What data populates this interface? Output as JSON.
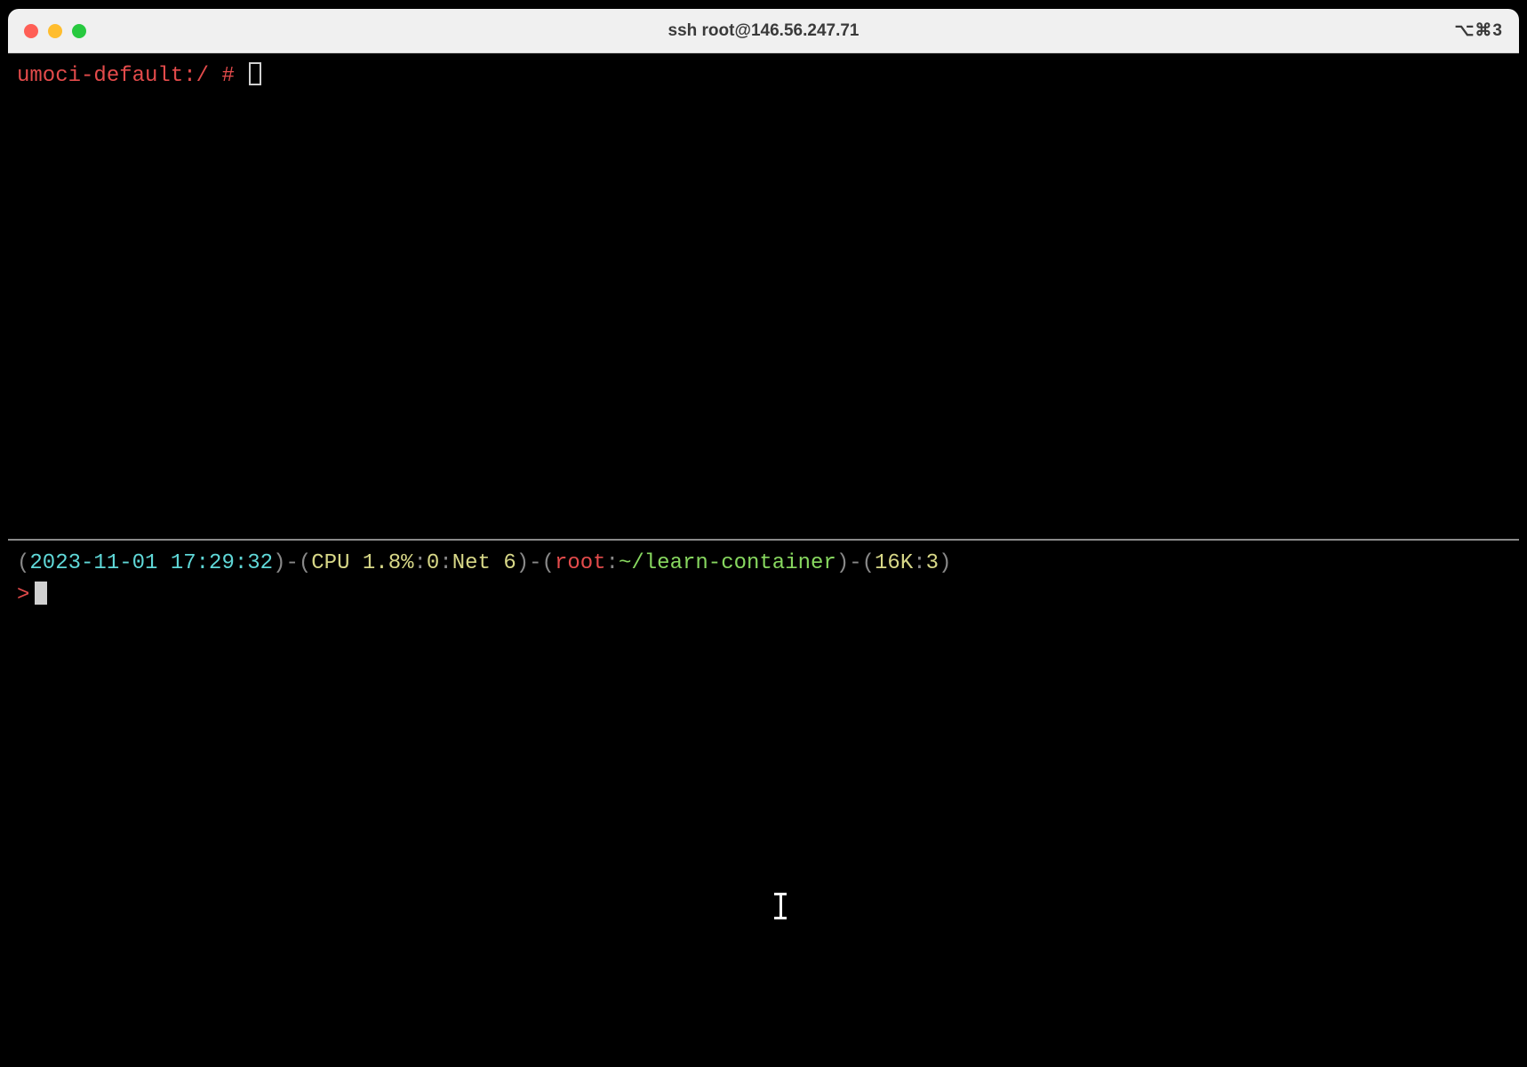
{
  "window": {
    "title": "ssh root@146.56.247.71",
    "shortcut": "⌥⌘3"
  },
  "pane_top": {
    "prompt": "umoci-default:/ # "
  },
  "pane_bottom": {
    "status": {
      "open1": "(",
      "timestamp": "2023-11-01 17:29:32",
      "close1": ")",
      "sep1": "-",
      "open2": "(",
      "cpu_label": "CPU 1.8%",
      "cpu_sep": ":",
      "zero": "0",
      "net_sep": ":",
      "net_label": "Net 6",
      "close2": ")",
      "sep2": "-",
      "open3": "(",
      "user": "root",
      "user_sep": ":",
      "path": "~/learn-container",
      "close3": ")",
      "sep3": "-",
      "open4": "(",
      "size": "16K",
      "size_sep": ":",
      "count": "3",
      "close4": ")"
    },
    "prompt_char": ">"
  }
}
